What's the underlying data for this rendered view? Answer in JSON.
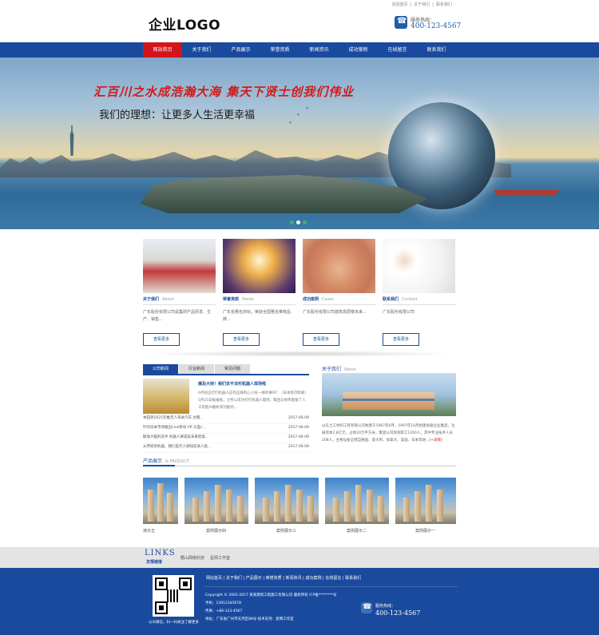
{
  "top_links": [
    "返回首页",
    "关于我们",
    "联系我们"
  ],
  "logo": "企业LOGO",
  "hotline": {
    "label": "服务热线：",
    "number": "400-123-4567"
  },
  "nav": [
    "网站首页",
    "关于我们",
    "产品展示",
    "荣誉资质",
    "新闻资讯",
    "成功案例",
    "在线留言",
    "联系我们"
  ],
  "banner": {
    "slogan1": "汇百川之水成浩瀚大海  集天下贤士创我们伟业",
    "slogan2": "我们的理想：让更多人生活更幸福",
    "slide_count": 3,
    "active_slide": 2
  },
  "cards": [
    {
      "title": "关于我们",
      "en": "About",
      "desc": "广东股份有限公司是集研产品研发、生产、销售...",
      "btn": "查看更多"
    },
    {
      "title": "荣誉资质",
      "en": "Honor",
      "desc": "广东省著名商标，荣获全国著名推荐品牌...",
      "btn": "查看更多"
    },
    {
      "title": "成功案例",
      "en": "Cases",
      "desc": "广东股份有限公司建筑高层楼未来...",
      "btn": "查看更多"
    },
    {
      "title": "联系我们",
      "en": "Contact",
      "desc": "广东股份有限公司",
      "btn": "查看更多"
    }
  ],
  "news": {
    "tabs": [
      "公司新闻",
      "行业新闻",
      "常见问题"
    ],
    "headline": "摘及大快！我们去不法衬机器人现场啦",
    "summary": "6月初这打打机器人征检这样的心小孩一样的事吗？（日本经济新闻）5月25日据报纸，之所以成为打打机器人能够，集团与他率配备了人工智能AI搬机等功能的...",
    "items": [
      {
        "title": "本田到2025年推无人驾驶汽车 达两...",
        "date": "2017-06-09"
      },
      {
        "title": "针对日本市场推出Link移动 VR 头盔(...",
        "date": "2017-06-09"
      },
      {
        "title": "解放大脑的双手 机器人要成就未来智能...",
        "date": "2017-06-09"
      },
      {
        "title": "从传统到机器，我们是代人感知前进人类...",
        "date": "2017-06-09"
      }
    ]
  },
  "about": {
    "title": "关于我们",
    "en": "About",
    "text": "山东土工材料工程有限公司始建于1987年6月，1997年10月组建省级企业集团，注册资本1.8亿元，占地20万平方米。集团公司现有职工1200人，其中专业技术人员208人，主要设备全部自德国、意大利、加拿大、美国、日本等进...",
    "more": "[+详情]"
  },
  "products": {
    "title": "产品展示",
    "en": "& PRODUCT",
    "items": [
      "演示五",
      "案例展示四",
      "案例展示三",
      "案例展示二",
      "案例展示一"
    ]
  },
  "links": {
    "en": "LINKS",
    "cn": "友情链接",
    "items": [
      "酷山网络科技",
      "星网工作室"
    ]
  },
  "footer": {
    "nav": [
      "网站首页",
      "关于我们",
      "产品展示",
      "荣誉资质",
      "新闻资讯",
      "成功案例",
      "在线留言",
      "联系我们"
    ],
    "copyright": "Copyright © 2002-2017 某某建筑工程施工有限公司 版权所有 ICP备********号",
    "phone": "手机：13912345678",
    "fax": "传真：+86-123-4567",
    "address": "地址：广东省广州市天河区88号 技术支持：星网工作室",
    "qr_caption": "公众微信，扫一扫关注了解更多"
  },
  "colors": {
    "primary": "#1a4a9d",
    "accent": "#d3151b"
  }
}
